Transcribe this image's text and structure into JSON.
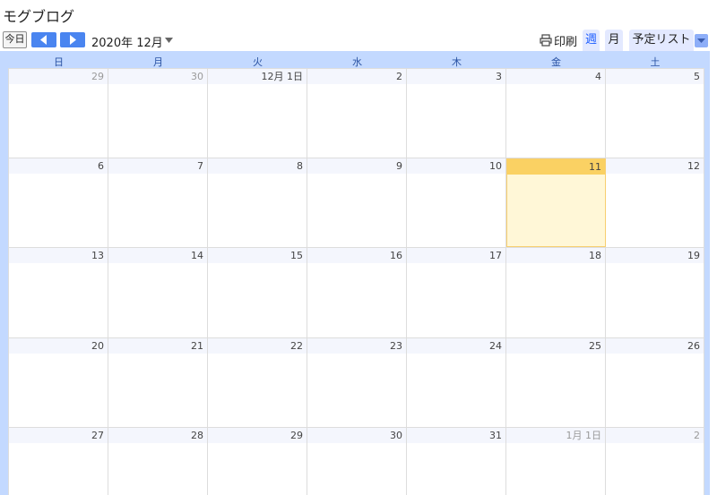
{
  "app": {
    "title": "モグブログ"
  },
  "toolbar": {
    "today_label": "今日",
    "range_label": "2020年 12月",
    "print_label": "印刷",
    "tabs": {
      "week": "週",
      "month": "月",
      "agenda": "予定リスト"
    }
  },
  "calendar": {
    "weekdays": [
      "日",
      "月",
      "火",
      "水",
      "木",
      "金",
      "土"
    ],
    "weeks": [
      [
        {
          "label": "29",
          "other": true
        },
        {
          "label": "30",
          "other": true
        },
        {
          "label": "12月 1日"
        },
        {
          "label": "2"
        },
        {
          "label": "3"
        },
        {
          "label": "4"
        },
        {
          "label": "5"
        }
      ],
      [
        {
          "label": "6"
        },
        {
          "label": "7"
        },
        {
          "label": "8"
        },
        {
          "label": "9"
        },
        {
          "label": "10"
        },
        {
          "label": "11",
          "today": true
        },
        {
          "label": "12"
        }
      ],
      [
        {
          "label": "13"
        },
        {
          "label": "14"
        },
        {
          "label": "15"
        },
        {
          "label": "16"
        },
        {
          "label": "17"
        },
        {
          "label": "18"
        },
        {
          "label": "19"
        }
      ],
      [
        {
          "label": "20"
        },
        {
          "label": "21"
        },
        {
          "label": "22"
        },
        {
          "label": "23"
        },
        {
          "label": "24"
        },
        {
          "label": "25"
        },
        {
          "label": "26"
        }
      ],
      [
        {
          "label": "27"
        },
        {
          "label": "28"
        },
        {
          "label": "29"
        },
        {
          "label": "30"
        },
        {
          "label": "31"
        },
        {
          "label": "1月 1日",
          "other": true
        },
        {
          "label": "2",
          "other": true
        }
      ]
    ]
  }
}
